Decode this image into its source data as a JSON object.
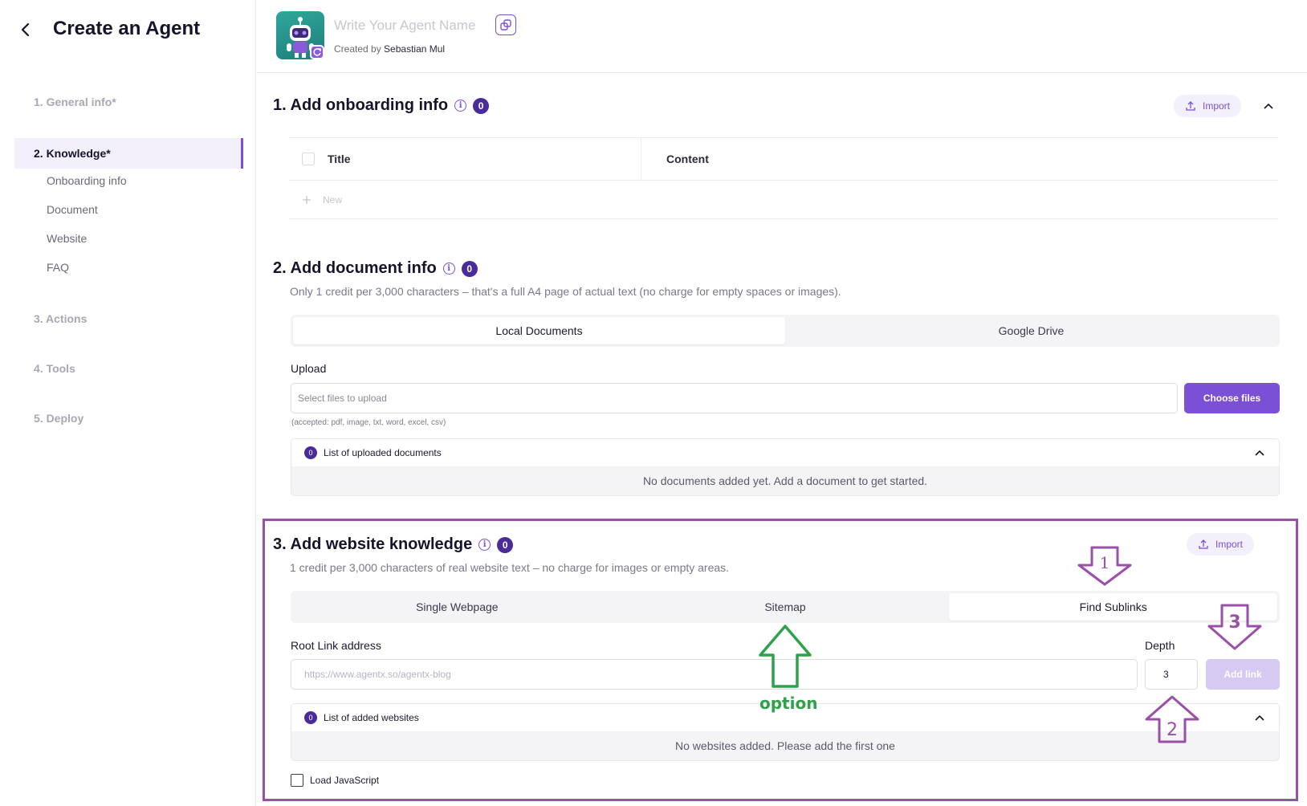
{
  "sidebar": {
    "title": "Create an Agent",
    "steps": {
      "general": "1. General info*",
      "knowledge": "2. Knowledge*",
      "actions": "3. Actions",
      "tools": "4. Tools",
      "deploy": "5. Deploy"
    },
    "knowledge_sub": [
      "Onboarding info",
      "Document",
      "Website",
      "FAQ"
    ]
  },
  "header": {
    "name_placeholder": "Write Your Agent Name",
    "created_by_label": "Created by",
    "creator": "Sebastian Mul"
  },
  "onboarding": {
    "title": "1. Add onboarding info",
    "count": "0",
    "import_label": "Import",
    "columns": [
      "Title",
      "Content"
    ],
    "new_label": "New"
  },
  "document": {
    "title": "2. Add document info",
    "count": "0",
    "description": "Only 1 credit per 3,000 characters – that's a full A4 page of actual text (no charge for empty spaces or images).",
    "tabs": [
      "Local Documents",
      "Google Drive"
    ],
    "upload_label": "Upload",
    "upload_placeholder": "Select files to upload",
    "choose_label": "Choose files",
    "accepted_hint": "(accepted: pdf, image, txt, word, excel, csv)",
    "list_count": "0",
    "list_title": "List of uploaded documents",
    "list_empty": "No documents added yet. Add a document to get started."
  },
  "website": {
    "title": "3. Add website knowledge",
    "count": "0",
    "import_label": "Import",
    "description": "1 credit per 3,000 characters of real website text – no charge for images or empty areas.",
    "tabs": [
      "Single Webpage",
      "Sitemap",
      "Find Sublinks"
    ],
    "root_label": "Root Link address",
    "root_placeholder": "https://www.agentx.so/agentx-blog",
    "depth_label": "Depth",
    "depth_value": "3",
    "add_link_label": "Add link",
    "list_count": "0",
    "list_title": "List of added websites",
    "list_empty": "No websites added. Please add the first one",
    "load_js_label": "Load JavaScript"
  },
  "annotations": {
    "arrow1": "1",
    "arrow2": "2",
    "arrow3": "3",
    "option": "option"
  },
  "colors": {
    "accent": "#7b4fd6",
    "badge": "#4b2a9a",
    "highlight": "#9a4fa8",
    "option_green": "#2ea24a"
  }
}
